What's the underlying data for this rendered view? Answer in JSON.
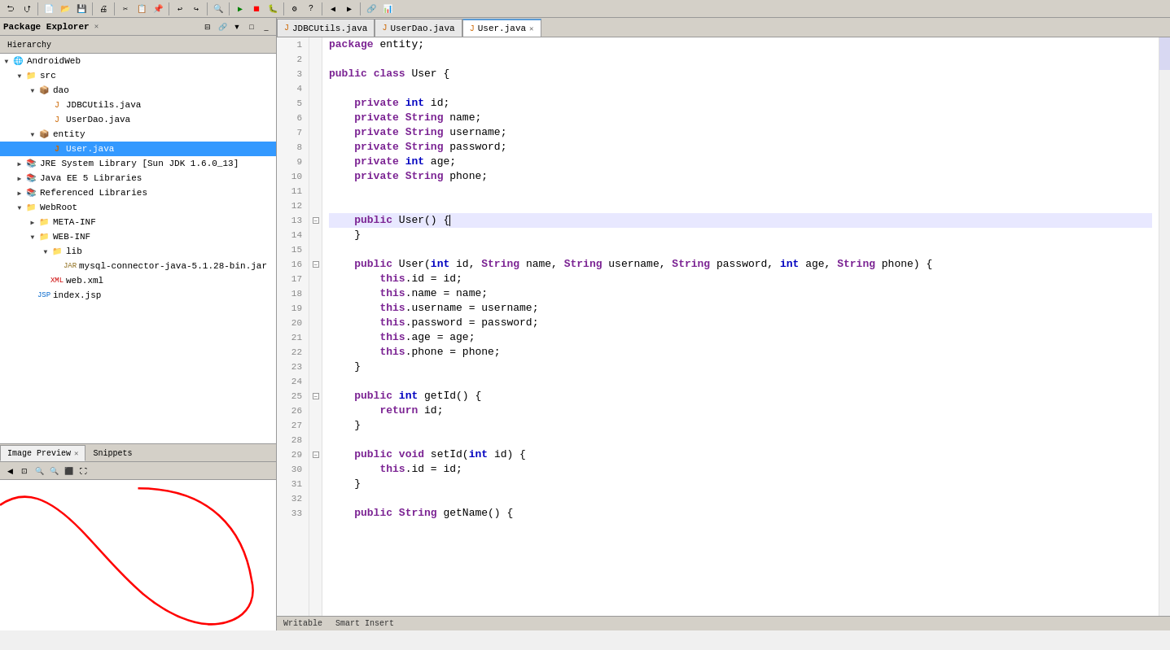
{
  "toolbar": {
    "buttons": [
      "⮌",
      "⮍",
      "▶",
      "⏹",
      "⏸",
      "🔧",
      "⚙",
      "🔍",
      "☰",
      "📋",
      "📄",
      "💾",
      "🖨",
      "✂",
      "📋",
      "📌",
      "↩",
      "↪",
      "🔎",
      "🔍",
      "⬛",
      "⬜",
      "▶",
      "⏭",
      "⏬",
      "⚡",
      "🔗",
      "🔒",
      "🛡",
      "📊",
      "⬛"
    ]
  },
  "left_panel": {
    "tabs": [
      {
        "id": "package-explorer",
        "label": "Package Explorer",
        "active": true
      },
      {
        "id": "hierarchy",
        "label": "Hierarchy",
        "active": false
      }
    ],
    "tree": [
      {
        "level": 0,
        "expand": "▼",
        "icon": "🌐",
        "icon_class": "icon-project",
        "label": "AndroidWeb",
        "selected": false
      },
      {
        "level": 1,
        "expand": "▼",
        "icon": "📁",
        "icon_class": "icon-folder",
        "label": "src",
        "selected": false
      },
      {
        "level": 2,
        "expand": "▼",
        "icon": "📦",
        "icon_class": "icon-package",
        "label": "dao",
        "selected": false
      },
      {
        "level": 3,
        "expand": "",
        "icon": "☕",
        "icon_class": "icon-java",
        "label": "JDBCUtils.java",
        "selected": false
      },
      {
        "level": 3,
        "expand": "",
        "icon": "☕",
        "icon_class": "icon-java",
        "label": "UserDao.java",
        "selected": false
      },
      {
        "level": 2,
        "expand": "▼",
        "icon": "📦",
        "icon_class": "icon-package",
        "label": "entity",
        "selected": false
      },
      {
        "level": 3,
        "expand": "",
        "icon": "☕",
        "icon_class": "icon-java",
        "label": "User.java",
        "selected": true
      },
      {
        "level": 1,
        "expand": "▶",
        "icon": "📚",
        "icon_class": "icon-library",
        "label": "JRE System Library [Sun JDK 1.6.0_13]",
        "selected": false
      },
      {
        "level": 1,
        "expand": "▶",
        "icon": "📚",
        "icon_class": "icon-library",
        "label": "Java EE 5 Libraries",
        "selected": false
      },
      {
        "level": 1,
        "expand": "▶",
        "icon": "📚",
        "icon_class": "icon-library",
        "label": "Referenced Libraries",
        "selected": false
      },
      {
        "level": 1,
        "expand": "▼",
        "icon": "📁",
        "icon_class": "icon-folder",
        "label": "WebRoot",
        "selected": false
      },
      {
        "level": 2,
        "expand": "▶",
        "icon": "📁",
        "icon_class": "icon-folder",
        "label": "META-INF",
        "selected": false
      },
      {
        "level": 2,
        "expand": "▼",
        "icon": "📁",
        "icon_class": "icon-folder",
        "label": "WEB-INF",
        "selected": false
      },
      {
        "level": 3,
        "expand": "▼",
        "icon": "📁",
        "icon_class": "icon-folder",
        "label": "lib",
        "selected": false
      },
      {
        "level": 4,
        "expand": "",
        "icon": "🫙",
        "icon_class": "icon-jar",
        "label": "mysql-connector-java-5.1.28-bin.jar",
        "selected": false
      },
      {
        "level": 3,
        "expand": "",
        "icon": "📄",
        "icon_class": "icon-xml",
        "label": "web.xml",
        "selected": false
      },
      {
        "level": 2,
        "expand": "",
        "icon": "📄",
        "icon_class": "icon-jsp",
        "label": "index.jsp",
        "selected": false
      }
    ]
  },
  "bottom_panel": {
    "tabs": [
      {
        "id": "image-preview",
        "label": "Image Preview",
        "active": true
      },
      {
        "id": "snippets",
        "label": "Snippets",
        "active": false
      }
    ]
  },
  "editor": {
    "tabs": [
      {
        "id": "jdbcutils",
        "label": "JDBCUtils.java",
        "active": false,
        "modified": false
      },
      {
        "id": "userdao",
        "label": "UserDao.java",
        "active": false,
        "modified": false
      },
      {
        "id": "user",
        "label": "User.java",
        "active": true,
        "modified": false
      }
    ],
    "code_lines": [
      {
        "num": 1,
        "fold": false,
        "fold_open": false,
        "text": "package entity;",
        "tokens": [
          {
            "t": "kw",
            "v": "package"
          },
          {
            "t": "plain",
            "v": " entity;"
          }
        ]
      },
      {
        "num": 2,
        "fold": false,
        "fold_open": false,
        "text": ""
      },
      {
        "num": 3,
        "fold": false,
        "fold_open": false,
        "text": "public class User {",
        "tokens": [
          {
            "t": "kw",
            "v": "public"
          },
          {
            "t": "plain",
            "v": " "
          },
          {
            "t": "kw",
            "v": "class"
          },
          {
            "t": "plain",
            "v": " User {"
          }
        ]
      },
      {
        "num": 4,
        "fold": false,
        "fold_open": false,
        "text": ""
      },
      {
        "num": 5,
        "fold": false,
        "fold_open": false,
        "text": "    private int id;",
        "tokens": [
          {
            "t": "plain",
            "v": "    "
          },
          {
            "t": "kw",
            "v": "private"
          },
          {
            "t": "plain",
            "v": " "
          },
          {
            "t": "kw2",
            "v": "int"
          },
          {
            "t": "plain",
            "v": " id;"
          }
        ]
      },
      {
        "num": 6,
        "fold": false,
        "fold_open": false,
        "text": "    private String name;",
        "tokens": [
          {
            "t": "plain",
            "v": "    "
          },
          {
            "t": "kw",
            "v": "private"
          },
          {
            "t": "plain",
            "v": " "
          },
          {
            "t": "type",
            "v": "String"
          },
          {
            "t": "plain",
            "v": " name;"
          }
        ]
      },
      {
        "num": 7,
        "fold": false,
        "fold_open": false,
        "text": "    private String username;",
        "tokens": [
          {
            "t": "plain",
            "v": "    "
          },
          {
            "t": "kw",
            "v": "private"
          },
          {
            "t": "plain",
            "v": " "
          },
          {
            "t": "type",
            "v": "String"
          },
          {
            "t": "plain",
            "v": " username;"
          }
        ]
      },
      {
        "num": 8,
        "fold": false,
        "fold_open": false,
        "text": "    private String password;",
        "tokens": [
          {
            "t": "plain",
            "v": "    "
          },
          {
            "t": "kw",
            "v": "private"
          },
          {
            "t": "plain",
            "v": " "
          },
          {
            "t": "type",
            "v": "String"
          },
          {
            "t": "plain",
            "v": " password;"
          }
        ]
      },
      {
        "num": 9,
        "fold": false,
        "fold_open": false,
        "text": "    private int age;",
        "tokens": [
          {
            "t": "plain",
            "v": "    "
          },
          {
            "t": "kw",
            "v": "private"
          },
          {
            "t": "plain",
            "v": " "
          },
          {
            "t": "kw2",
            "v": "int"
          },
          {
            "t": "plain",
            "v": " age;"
          }
        ]
      },
      {
        "num": 10,
        "fold": false,
        "fold_open": false,
        "text": "    private String phone;",
        "tokens": [
          {
            "t": "plain",
            "v": "    "
          },
          {
            "t": "kw",
            "v": "private"
          },
          {
            "t": "plain",
            "v": " "
          },
          {
            "t": "type",
            "v": "String"
          },
          {
            "t": "plain",
            "v": " phone;"
          }
        ]
      },
      {
        "num": 11,
        "fold": false,
        "fold_open": false,
        "text": ""
      },
      {
        "num": 12,
        "fold": false,
        "fold_open": false,
        "text": ""
      },
      {
        "num": 13,
        "fold": true,
        "fold_open": true,
        "text": "    public User() {",
        "tokens": [
          {
            "t": "plain",
            "v": "    "
          },
          {
            "t": "kw",
            "v": "public"
          },
          {
            "t": "plain",
            "v": " User() {"
          }
        ],
        "cursor": true
      },
      {
        "num": 14,
        "fold": false,
        "fold_open": false,
        "text": "    }"
      },
      {
        "num": 15,
        "fold": false,
        "fold_open": false,
        "text": ""
      },
      {
        "num": 16,
        "fold": true,
        "fold_open": true,
        "text": "    public User(int id, String name, String username, String password, int age, String phone) {",
        "tokens": [
          {
            "t": "plain",
            "v": "    "
          },
          {
            "t": "kw",
            "v": "public"
          },
          {
            "t": "plain",
            "v": " User("
          },
          {
            "t": "kw2",
            "v": "int"
          },
          {
            "t": "plain",
            "v": " id, "
          },
          {
            "t": "type",
            "v": "String"
          },
          {
            "t": "plain",
            "v": " name, "
          },
          {
            "t": "type",
            "v": "String"
          },
          {
            "t": "plain",
            "v": " username, "
          },
          {
            "t": "type",
            "v": "String"
          },
          {
            "t": "plain",
            "v": " password, "
          },
          {
            "t": "kw2",
            "v": "int"
          },
          {
            "t": "plain",
            "v": " age, "
          },
          {
            "t": "type",
            "v": "String"
          },
          {
            "t": "plain",
            "v": " phone) {"
          }
        ]
      },
      {
        "num": 17,
        "fold": false,
        "fold_open": false,
        "text": "        this.id = id;",
        "tokens": [
          {
            "t": "plain",
            "v": "        "
          },
          {
            "t": "kw",
            "v": "this"
          },
          {
            "t": "plain",
            "v": ".id = id;"
          }
        ]
      },
      {
        "num": 18,
        "fold": false,
        "fold_open": false,
        "text": "        this.name = name;",
        "tokens": [
          {
            "t": "plain",
            "v": "        "
          },
          {
            "t": "kw",
            "v": "this"
          },
          {
            "t": "plain",
            "v": ".name = name;"
          }
        ]
      },
      {
        "num": 19,
        "fold": false,
        "fold_open": false,
        "text": "        this.username = username;",
        "tokens": [
          {
            "t": "plain",
            "v": "        "
          },
          {
            "t": "kw",
            "v": "this"
          },
          {
            "t": "plain",
            "v": ".username = username;"
          }
        ]
      },
      {
        "num": 20,
        "fold": false,
        "fold_open": false,
        "text": "        this.password = password;",
        "tokens": [
          {
            "t": "plain",
            "v": "        "
          },
          {
            "t": "kw",
            "v": "this"
          },
          {
            "t": "plain",
            "v": ".password = password;"
          }
        ]
      },
      {
        "num": 21,
        "fold": false,
        "fold_open": false,
        "text": "        this.age = age;",
        "tokens": [
          {
            "t": "plain",
            "v": "        "
          },
          {
            "t": "kw",
            "v": "this"
          },
          {
            "t": "plain",
            "v": ".age = age;"
          }
        ]
      },
      {
        "num": 22,
        "fold": false,
        "fold_open": false,
        "text": "        this.phone = phone;",
        "tokens": [
          {
            "t": "plain",
            "v": "        "
          },
          {
            "t": "kw",
            "v": "this"
          },
          {
            "t": "plain",
            "v": ".phone = phone;"
          }
        ]
      },
      {
        "num": 23,
        "fold": false,
        "fold_open": false,
        "text": "    }"
      },
      {
        "num": 24,
        "fold": false,
        "fold_open": false,
        "text": ""
      },
      {
        "num": 25,
        "fold": true,
        "fold_open": true,
        "text": "    public int getId() {",
        "tokens": [
          {
            "t": "plain",
            "v": "    "
          },
          {
            "t": "kw",
            "v": "public"
          },
          {
            "t": "plain",
            "v": " "
          },
          {
            "t": "kw2",
            "v": "int"
          },
          {
            "t": "plain",
            "v": " getId() {"
          }
        ]
      },
      {
        "num": 26,
        "fold": false,
        "fold_open": false,
        "text": "        return id;",
        "tokens": [
          {
            "t": "plain",
            "v": "        "
          },
          {
            "t": "kw",
            "v": "return"
          },
          {
            "t": "plain",
            "v": " id;"
          }
        ]
      },
      {
        "num": 27,
        "fold": false,
        "fold_open": false,
        "text": "    }"
      },
      {
        "num": 28,
        "fold": false,
        "fold_open": false,
        "text": ""
      },
      {
        "num": 29,
        "fold": true,
        "fold_open": true,
        "text": "    public void setId(int id) {",
        "tokens": [
          {
            "t": "plain",
            "v": "    "
          },
          {
            "t": "kw",
            "v": "public"
          },
          {
            "t": "plain",
            "v": " "
          },
          {
            "t": "kw",
            "v": "void"
          },
          {
            "t": "plain",
            "v": " setId("
          },
          {
            "t": "kw2",
            "v": "int"
          },
          {
            "t": "plain",
            "v": " id) {"
          }
        ]
      },
      {
        "num": 30,
        "fold": false,
        "fold_open": false,
        "text": "        this.id = id;",
        "tokens": [
          {
            "t": "plain",
            "v": "        "
          },
          {
            "t": "kw",
            "v": "this"
          },
          {
            "t": "plain",
            "v": ".id = id;"
          }
        ]
      },
      {
        "num": 31,
        "fold": false,
        "fold_open": false,
        "text": "    }"
      },
      {
        "num": 32,
        "fold": false,
        "fold_open": false,
        "text": ""
      },
      {
        "num": 33,
        "fold": true,
        "fold_open": true,
        "text": "    public String getName() {",
        "tokens": [
          {
            "t": "plain",
            "v": "    "
          },
          {
            "t": "kw",
            "v": "public"
          },
          {
            "t": "plain",
            "v": " "
          },
          {
            "t": "type",
            "v": "String"
          },
          {
            "t": "plain",
            "v": " getName() {"
          }
        ]
      }
    ]
  },
  "status_bar": {
    "position": "Writable",
    "smart_insert": "Smart Insert"
  }
}
